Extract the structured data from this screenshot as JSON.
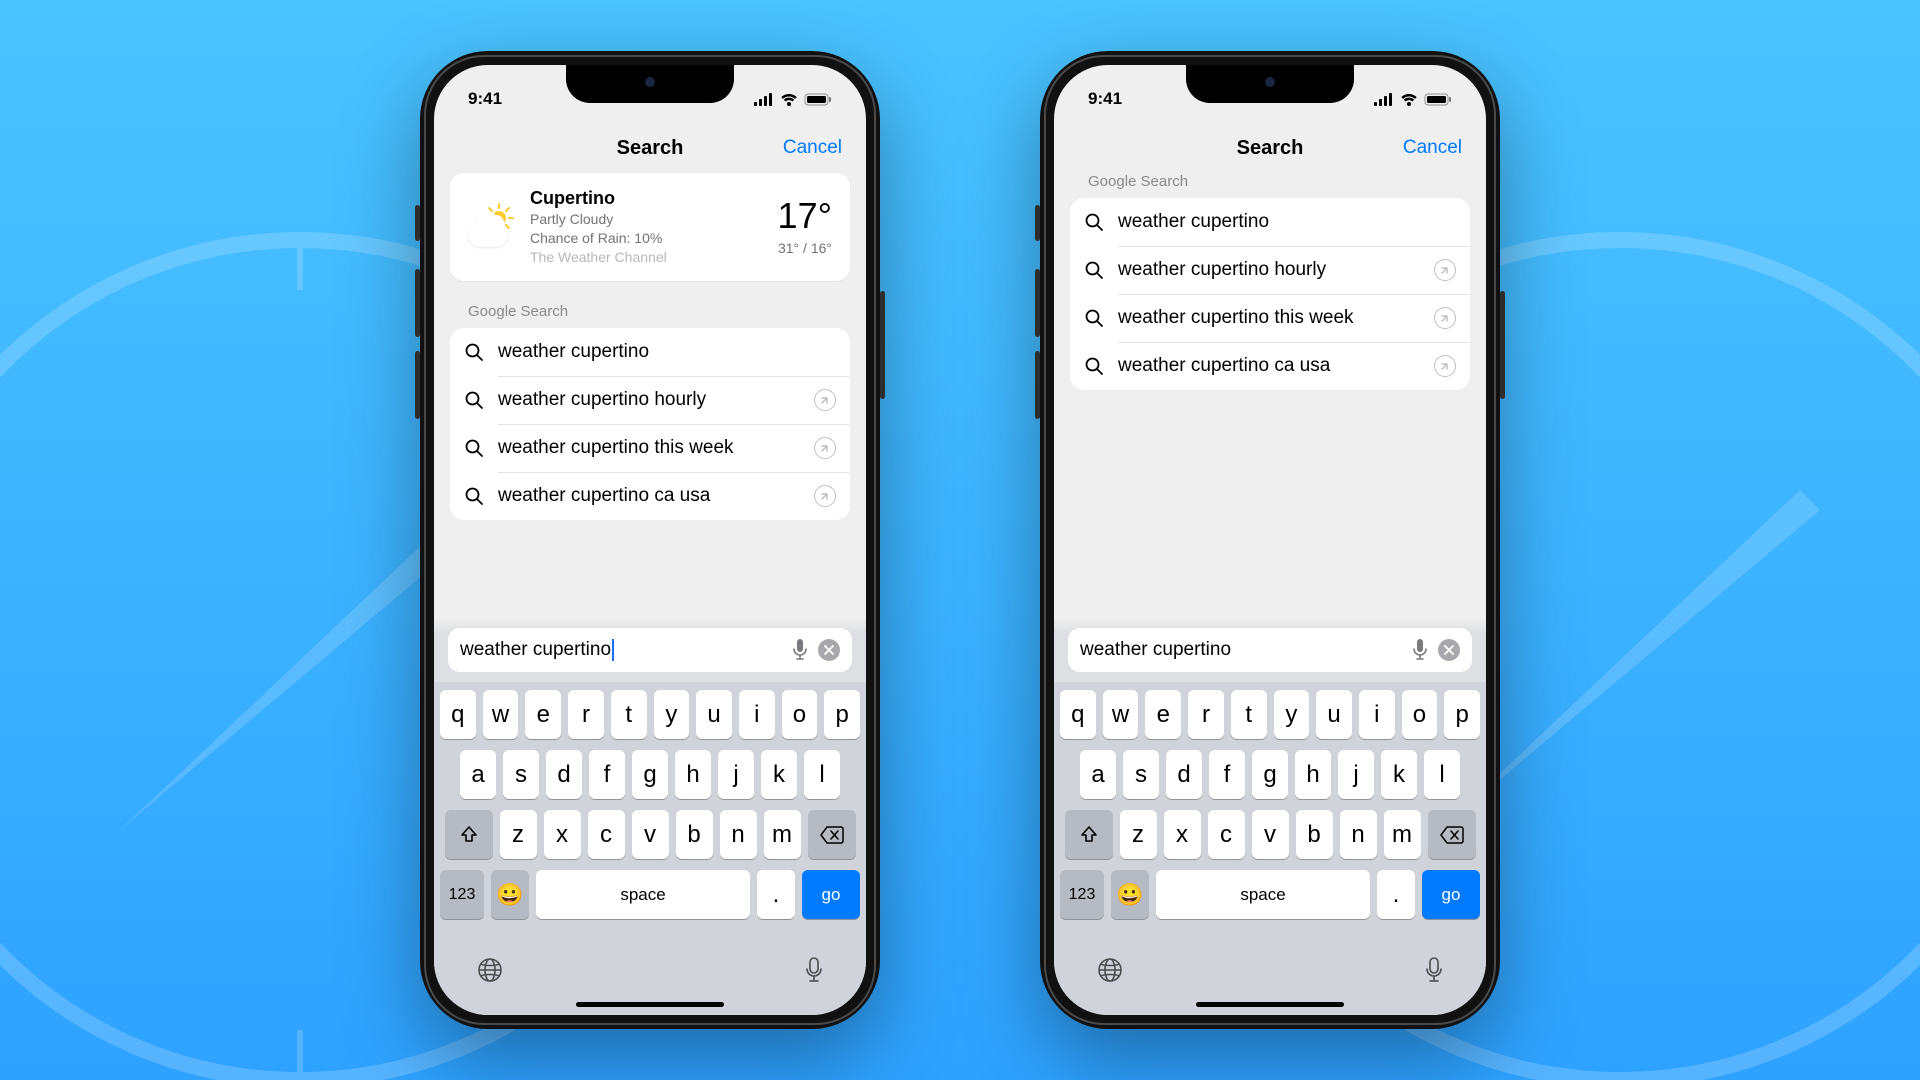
{
  "statusbar": {
    "time": "9:41"
  },
  "navbar": {
    "title": "Search",
    "cancel": "Cancel"
  },
  "weather": {
    "city": "Cupertino",
    "condition": "Partly Cloudy",
    "rain": "Chance of Rain: 10%",
    "source": "The Weather Channel",
    "temp": "17°",
    "range": "31° / 16°"
  },
  "section_label": "Google Search",
  "suggestions": [
    {
      "q": "weather cupertino",
      "fill": false
    },
    {
      "q": "weather cupertino hourly",
      "fill": true
    },
    {
      "q": "weather cupertino this week",
      "fill": true
    },
    {
      "q": "weather cupertino ca usa",
      "fill": true
    }
  ],
  "search": {
    "value": "weather cupertino"
  },
  "keyboard": {
    "row1": [
      "q",
      "w",
      "e",
      "r",
      "t",
      "y",
      "u",
      "i",
      "o",
      "p"
    ],
    "row2": [
      "a",
      "s",
      "d",
      "f",
      "g",
      "h",
      "j",
      "k",
      "l"
    ],
    "row3": [
      "z",
      "x",
      "c",
      "v",
      "b",
      "n",
      "m"
    ],
    "numLabel": "123",
    "space": "space",
    "period": ".",
    "go": "go",
    "emoji": "😀"
  }
}
